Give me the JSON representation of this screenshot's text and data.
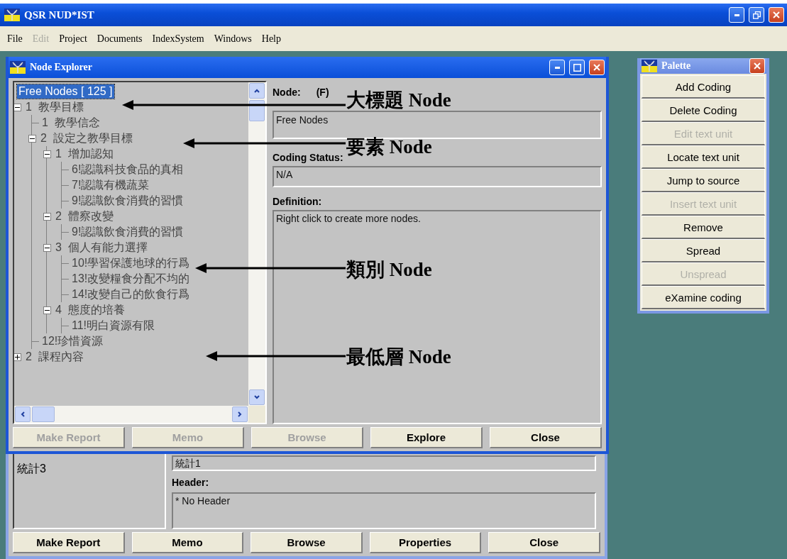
{
  "app": {
    "title": "QSR NUD*IST"
  },
  "menu": [
    {
      "label": "File",
      "disabled": false
    },
    {
      "label": "Edit",
      "disabled": true
    },
    {
      "label": "Project",
      "disabled": false
    },
    {
      "label": "Documents",
      "disabled": false
    },
    {
      "label": "IndexSystem",
      "disabled": false
    },
    {
      "label": "Windows",
      "disabled": false
    },
    {
      "label": "Help",
      "disabled": false
    }
  ],
  "node_explorer": {
    "title": "Node Explorer",
    "tree": {
      "label": "Free Nodes [ 125 ]",
      "selected": true,
      "children": [
        {
          "label": "1  教學目標",
          "selected": false,
          "expanded": true,
          "children": [
            {
              "label": "1  教學信念",
              "selected": false
            },
            {
              "label": "2  設定之教學目標",
              "selected": false,
              "expanded": true,
              "children": [
                {
                  "label": "1  增加認知",
                  "selected": false,
                  "expanded": true,
                  "children": [
                    {
                      "label": "6!認識科技食品的真相",
                      "selected": false
                    },
                    {
                      "label": "7!認識有機蔬菜",
                      "selected": false
                    },
                    {
                      "label": "9!認識飲食消費的習慣",
                      "selected": false
                    }
                  ]
                },
                {
                  "label": "2  體察改變",
                  "selected": false,
                  "expanded": true,
                  "children": [
                    {
                      "label": "9!認識飲食消費的習慣",
                      "selected": false
                    }
                  ]
                },
                {
                  "label": "3  個人有能力選擇",
                  "selected": false,
                  "expanded": true,
                  "children": [
                    {
                      "label": "10!學習保護地球的行爲",
                      "selected": false
                    },
                    {
                      "label": "13!改變糧食分配不均的",
                      "selected": false
                    },
                    {
                      "label": "14!改變自己的飲食行爲",
                      "selected": false
                    }
                  ]
                },
                {
                  "label": "4  態度的培養",
                  "selected": false,
                  "expanded": true,
                  "children": [
                    {
                      "label": "11!明白資源有限",
                      "selected": false
                    }
                  ]
                }
              ]
            },
            {
              "label": "12!珍惜資源",
              "selected": false
            }
          ]
        },
        {
          "label": "2  課程內容",
          "selected": false,
          "expanded": false
        }
      ]
    },
    "node_label": "Node:",
    "node_type": "(F)",
    "node_value": "Free Nodes",
    "coding_status_label": "Coding Status:",
    "coding_status": "N/A",
    "definition_label": "Definition:",
    "definition": "Right click to create more nodes.",
    "buttons": [
      {
        "label": "Make Report",
        "disabled": true
      },
      {
        "label": "Memo",
        "disabled": true
      },
      {
        "label": "Browse",
        "disabled": true
      },
      {
        "label": "Explore",
        "disabled": false
      },
      {
        "label": "Close",
        "disabled": false
      }
    ]
  },
  "document_window": {
    "list_items": [
      "統計3"
    ],
    "field_value": "統計1",
    "header_label": "Header:",
    "header": "* No Header",
    "buttons": [
      {
        "label": "Make Report",
        "disabled": false
      },
      {
        "label": "Memo",
        "disabled": false
      },
      {
        "label": "Browse",
        "disabled": false
      },
      {
        "label": "Properties",
        "disabled": false
      },
      {
        "label": "Close",
        "disabled": false
      }
    ]
  },
  "palette": {
    "title": "Palette",
    "buttons": [
      {
        "label": "Add Coding",
        "disabled": false
      },
      {
        "label": "Delete Coding",
        "disabled": false
      },
      {
        "label": "Edit text unit",
        "disabled": true
      },
      {
        "label": "Locate text unit",
        "disabled": false
      },
      {
        "label": "Jump to source",
        "disabled": false
      },
      {
        "label": "Insert text unit",
        "disabled": true
      },
      {
        "label": "Remove",
        "disabled": false
      },
      {
        "label": "Spread",
        "disabled": false
      },
      {
        "label": "Unspread",
        "disabled": true
      },
      {
        "label": "eXamine coding",
        "disabled": false
      }
    ]
  },
  "annotations": [
    {
      "text": "大標題 Node"
    },
    {
      "text": "要素 Node"
    },
    {
      "text": "類別 Node"
    },
    {
      "text": "最低層 Node"
    }
  ]
}
